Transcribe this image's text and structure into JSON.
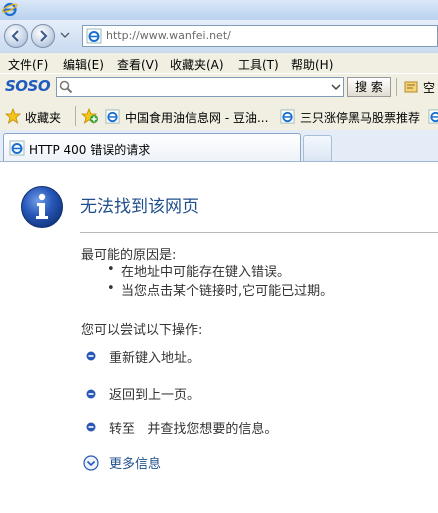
{
  "window": {
    "address_url": "http://www.wanfei.net/"
  },
  "menu": {
    "items": [
      "文件(F)",
      "编辑(E)",
      "查看(V)",
      "收藏夹(A)",
      "工具(T)",
      "帮助(H)"
    ]
  },
  "search_toolbar": {
    "logo_text": "SOSO",
    "search_button": "搜 索",
    "extra_label": "空"
  },
  "favorites_bar": {
    "label": "收藏夹",
    "links": [
      "中国食用油信息网 - 豆油...",
      "三只涨停黑马股票推荐"
    ]
  },
  "tabs": [
    {
      "title": "HTTP 400 错误的请求",
      "active": true
    }
  ],
  "error_page": {
    "title": "无法找到该网页",
    "cause_heading": "最可能的原因是:",
    "causes": [
      "在地址中可能存在键入错误。",
      "当您点击某个链接时,它可能已过期。"
    ],
    "try_heading": "您可以尝试以下操作:",
    "actions": [
      "重新键入地址。",
      "返回到上一页。",
      "转至   并查找您想要的信息。"
    ],
    "more_info": "更多信息"
  },
  "colors": {
    "title_blue": "#1f4e8c",
    "chrome_beige": "#f1efe2",
    "tab_blue": "#e3ecf7"
  },
  "icons": [
    "ie-logo-icon",
    "back-arrow-icon",
    "forward-arrow-icon",
    "search-icon",
    "star-icon",
    "add-favorite-icon",
    "info-icon",
    "chevron-down-icon",
    "bullet-icon"
  ]
}
